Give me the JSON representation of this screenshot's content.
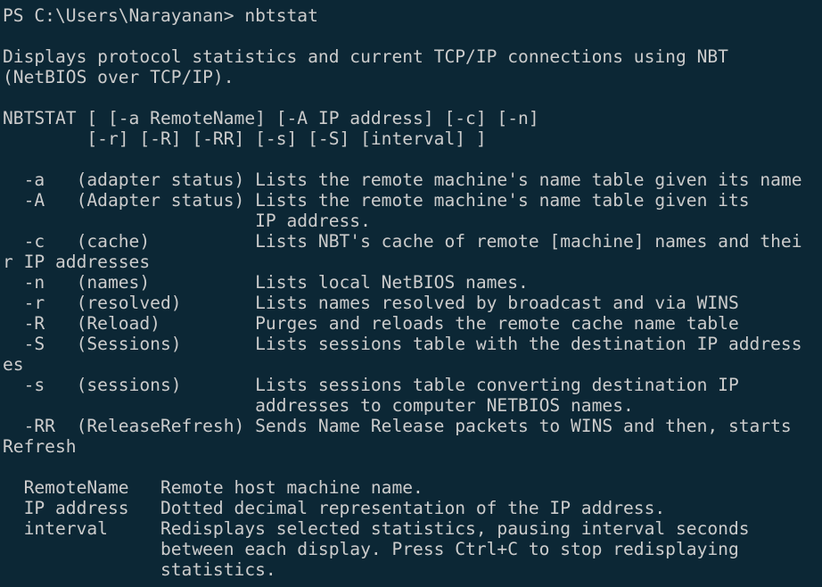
{
  "terminal": {
    "lines": [
      "PS C:\\Users\\Narayanan> nbtstat",
      "",
      "Displays protocol statistics and current TCP/IP connections using NBT",
      "(NetBIOS over TCP/IP).",
      "",
      "NBTSTAT [ [-a RemoteName] [-A IP address] [-c] [-n]",
      "        [-r] [-R] [-RR] [-s] [-S] [interval] ]",
      "",
      "  -a   (adapter status) Lists the remote machine's name table given its name",
      "  -A   (Adapter status) Lists the remote machine's name table given its",
      "                        IP address.",
      "  -c   (cache)          Lists NBT's cache of remote [machine] names and thei",
      "r IP addresses",
      "  -n   (names)          Lists local NetBIOS names.",
      "  -r   (resolved)       Lists names resolved by broadcast and via WINS",
      "  -R   (Reload)         Purges and reloads the remote cache name table",
      "  -S   (Sessions)       Lists sessions table with the destination IP address",
      "es",
      "  -s   (sessions)       Lists sessions table converting destination IP",
      "                        addresses to computer NETBIOS names.",
      "  -RR  (ReleaseRefresh) Sends Name Release packets to WINS and then, starts",
      "Refresh",
      "",
      "  RemoteName   Remote host machine name.",
      "  IP address   Dotted decimal representation of the IP address.",
      "  interval     Redisplays selected statistics, pausing interval seconds",
      "               between each display. Press Ctrl+C to stop redisplaying",
      "               statistics."
    ]
  }
}
